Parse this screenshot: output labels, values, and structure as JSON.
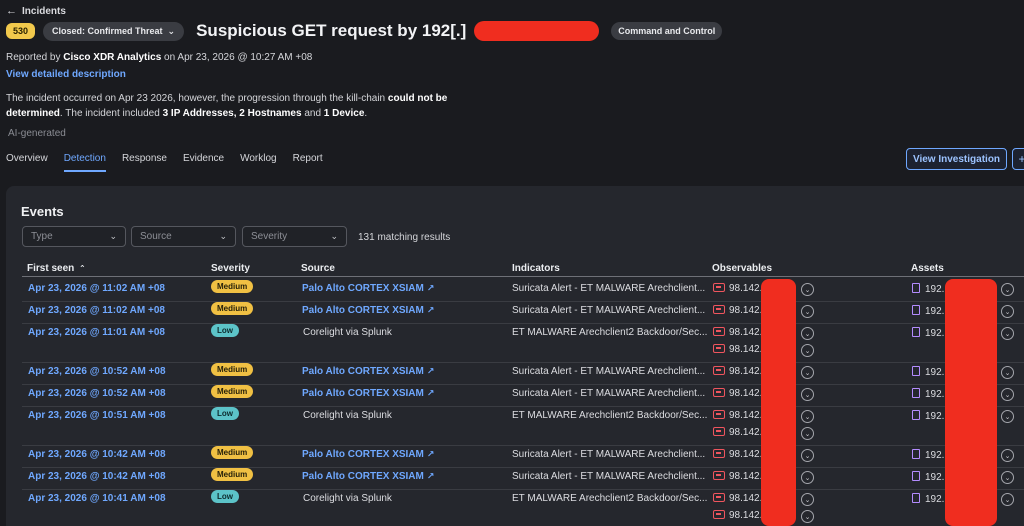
{
  "nav": {
    "back_label": "Incidents"
  },
  "incident": {
    "score": "530",
    "status": "Closed: Confirmed Threat",
    "title": "Suspicious GET request by 192[.]",
    "tag": "Command and Control",
    "reported_prefix": "Reported by",
    "reporter": "Cisco XDR Analytics",
    "reported_suffix": "on Apr 23, 2026 @ 10:27 AM +08",
    "view_description": "View detailed description",
    "summary_1": "The incident occurred on Apr 23 2026, however, the progression through the kill-chain",
    "summary_2": "could not be determined",
    "summary_3": ". The incident included",
    "summary_4": "3 IP Addresses, 2 Hostnames",
    "summary_5": "and",
    "summary_6": "1 Device",
    "summary_7": ".",
    "ai_generated": "AI-generated"
  },
  "tabs": [
    "Overview",
    "Detection",
    "Response",
    "Evidence",
    "Worklog",
    "Report"
  ],
  "actions": {
    "view_investigation": "View Investigation",
    "more": "+"
  },
  "events": {
    "title": "Events",
    "filters": {
      "type": "Type",
      "source": "Source",
      "severity": "Severity"
    },
    "matching": "131 matching results",
    "columns": [
      "First seen",
      "Severity",
      "Source",
      "Indicators",
      "Observables",
      "Assets"
    ],
    "rows": [
      {
        "first_seen": "Apr 23, 2026 @ 11:02 AM +08",
        "severity": "Medium",
        "source": "Palo Alto CORTEX XSIAM",
        "indicator": "Suricata Alert - ET MALWARE Arechclient...",
        "observables": [
          "98.142."
        ],
        "asset": "192."
      },
      {
        "first_seen": "Apr 23, 2026 @ 11:02 AM +08",
        "severity": "Medium",
        "source": "Palo Alto CORTEX XSIAM",
        "indicator": "Suricata Alert - ET MALWARE Arechclient...",
        "observables": [
          "98.142."
        ],
        "asset": "192."
      },
      {
        "first_seen": "Apr 23, 2026 @ 11:01 AM +08",
        "severity": "Low",
        "source": "Corelight via Splunk",
        "indicator": "ET MALWARE Arechclient2 Backdoor/Sec...",
        "observables": [
          "98.142.",
          "98.142."
        ],
        "asset": "192."
      },
      {
        "first_seen": "Apr 23, 2026 @ 10:52 AM +08",
        "severity": "Medium",
        "source": "Palo Alto CORTEX XSIAM",
        "indicator": "Suricata Alert - ET MALWARE Arechclient...",
        "observables": [
          "98.142."
        ],
        "asset": "192."
      },
      {
        "first_seen": "Apr 23, 2026 @ 10:52 AM +08",
        "severity": "Medium",
        "source": "Palo Alto CORTEX XSIAM",
        "indicator": "Suricata Alert - ET MALWARE Arechclient...",
        "observables": [
          "98.142."
        ],
        "asset": "192."
      },
      {
        "first_seen": "Apr 23, 2026 @ 10:51 AM +08",
        "severity": "Low",
        "source": "Corelight via Splunk",
        "indicator": "ET MALWARE Arechclient2 Backdoor/Sec...",
        "observables": [
          "98.142.",
          "98.142."
        ],
        "asset": "192."
      },
      {
        "first_seen": "Apr 23, 2026 @ 10:42 AM +08",
        "severity": "Medium",
        "source": "Palo Alto CORTEX XSIAM",
        "indicator": "Suricata Alert - ET MALWARE Arechclient...",
        "observables": [
          "98.142."
        ],
        "asset": "192."
      },
      {
        "first_seen": "Apr 23, 2026 @ 10:42 AM +08",
        "severity": "Medium",
        "source": "Palo Alto CORTEX XSIAM",
        "indicator": "Suricata Alert - ET MALWARE Arechclient...",
        "observables": [
          "98.142."
        ],
        "asset": "192."
      },
      {
        "first_seen": "Apr 23, 2026 @ 10:41 AM +08",
        "severity": "Low",
        "source": "Corelight via Splunk",
        "indicator": "ET MALWARE Arechclient2 Backdoor/Sec...",
        "observables": [
          "98.142.",
          "98.142."
        ],
        "asset": "192."
      }
    ]
  }
}
